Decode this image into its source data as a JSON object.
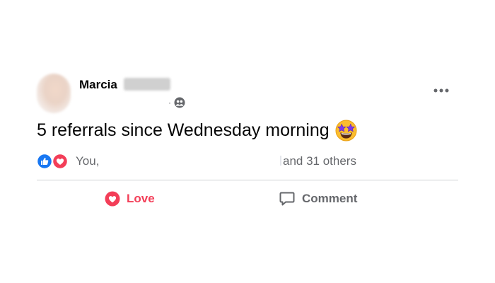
{
  "post": {
    "author_name": "Marcia",
    "meta_separator": "·",
    "audience_icon": "friends-audience-icon",
    "more_icon": "more-options-icon",
    "text": "5 referrals since Wednesday morning",
    "text_emoji": "star-struck-emoji"
  },
  "reactions": {
    "icons": [
      "like-reaction-icon",
      "love-reaction-icon"
    ],
    "you_text": "You,",
    "others_text": "and 31 others"
  },
  "actions": {
    "love_label": "Love",
    "comment_label": "Comment"
  },
  "colors": {
    "love_red": "#f33e58",
    "like_blue": "#1877f2",
    "secondary_text": "#65676b",
    "primary_text": "#050505",
    "divider": "#ced0d4"
  }
}
